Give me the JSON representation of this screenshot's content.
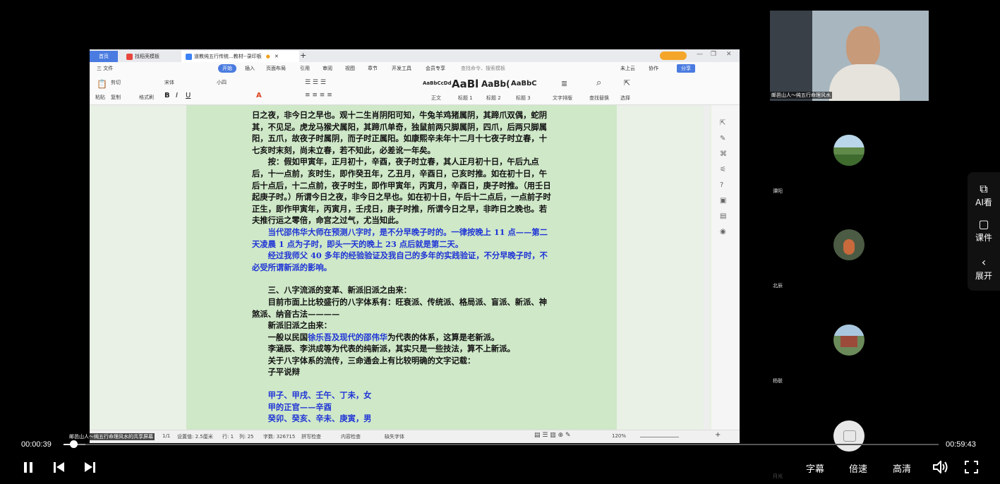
{
  "document_window": {
    "tabs": [
      {
        "label": "首页"
      },
      {
        "label": "找稻壳模板"
      },
      {
        "label": "道教纯五行传统...教材--录印板"
      }
    ],
    "menus": [
      "三 文件",
      "开始",
      "插入",
      "页面布局",
      "引用",
      "审阅",
      "视图",
      "章节",
      "开发工具",
      "会员专享",
      "查找命令、搜索模板"
    ],
    "right_menu": [
      "未上云",
      "协作",
      "分享"
    ],
    "ribbon": {
      "clipboard": [
        "粘贴",
        "剪切",
        "复制",
        "格式刷"
      ],
      "font_name": "宋体",
      "font_size": "小四",
      "styles": [
        {
          "preview": "AaBbCcDd",
          "label": "正文"
        },
        {
          "preview": "AaBl",
          "label": "标题 1"
        },
        {
          "preview": "AaBb(",
          "label": "标题 2"
        },
        {
          "preview": "AaBbC",
          "label": "标题 3"
        }
      ],
      "tools": [
        "文字排版",
        "查找替换",
        "选择"
      ]
    },
    "page_paragraphs": [
      {
        "text": "日之夜，非今日之早也。观十二生肖阴阳可知，牛兔羊鸡猪属阴，其蹄爪双偶，蛇阴其，不见足。虎龙马猴犬属阳，其蹄爪单奇，独鼠前两只脚属阴，四爪，后两只脚属阳，五爪，故夜子时属阴，而子时正属阳。如康熙辛未年十二月十七夜子时立春，十七亥时末刻，尚未立春，若不知此，必差讹一年矣。",
        "style": "plain"
      },
      {
        "text": "按：假如甲寅年，正月初十，辛酉，夜子时立春，其人正月初十日，午后九点后，十一点前，亥时生，即作癸丑年，乙丑月，辛酉日，己亥时推。如在初十日，午后十点后，十二点前，夜子时生，即作甲寅年，丙寅月，辛酉日，庚子时推。（用壬日起庚子时。）所谓今日之夜，非今日之早也。如在初十日，午后十二点后，一点前子时正生，即作甲寅年，丙寅月，壬戌日，庚子时推，所谓今日之早，非昨日之晚也。若夫推行运之零倍，命宫之过气，尤当知此。",
        "style": "indent"
      },
      {
        "text": "当代邵伟华大师在预测八字时，是不分早晚子时的。一律按晚上 11 点——第二天凌晨 1 点为子时，即头一天的晚上 23 点后就是第二天。",
        "style": "blue-indent"
      },
      {
        "text": "经过我师父 40 多年的经验验证及我自己的多年的实践验证，不分早晚子时，不必受所谓新派的影响。",
        "style": "blue-indent"
      },
      {
        "text": "",
        "style": "gap"
      },
      {
        "text": "三、八字流派的变革、新派旧派之由来：",
        "style": "indent"
      },
      {
        "text": "目前市面上比较盛行的八字体系有：旺衰派、传统派、格局派、盲派、新派、神煞派、纳音古法————",
        "style": "indent"
      },
      {
        "text": "新派旧派之由来：",
        "style": "indent"
      },
      {
        "text": "一般以民国徐乐吾及现代的邵伟华为代表的体系，这算是老新派。",
        "style": "mixed-indent"
      },
      {
        "text": "李涵辰、李洪成等为代表的纯新派，其实只是一些技法，算不上新派。",
        "style": "indent"
      },
      {
        "text": "关于八字体系的流传，三命通会上有比较明确的文字记载：",
        "style": "indent"
      },
      {
        "text": "子平说辩",
        "style": "indent"
      },
      {
        "text": "",
        "style": "gap"
      },
      {
        "text": "甲子、甲戌、壬午、丁未，女",
        "style": "blue-indent"
      },
      {
        "text": "甲的正官——辛酉",
        "style": "blue-indent"
      },
      {
        "text": "癸卯、癸亥、辛未、庚寅，男",
        "style": "blue-indent"
      }
    ],
    "mixed_line": {
      "prefix": "一般以民国",
      "blue": "徐乐吾及现代的邵伟华",
      "suffix": "为代表的体系，这算是老新派。"
    },
    "status": {
      "page": "1/1",
      "setting": "设置值: 2.5厘米",
      "line": "行: 1",
      "col": "列: 25",
      "words": "字数: 326715",
      "spell": "拼写检查",
      "content": "内容检查",
      "font_missing": "缺失字体",
      "zoom": "120%"
    },
    "share_caption": "邮邑山人～纯五行命理风水的共享屏幕"
  },
  "participants": [
    {
      "name": "邮邑山人～纯五行命理风水",
      "role": "host"
    },
    {
      "name": "谭阳"
    },
    {
      "name": "北辰"
    },
    {
      "name": "杨联"
    },
    {
      "name": "月光"
    }
  ],
  "player": {
    "current_time": "00:00:39",
    "total_time": "00:59:43",
    "progress": 0.011,
    "subtitles_label": "字幕",
    "speed_label": "倍速",
    "quality_label": "高清"
  },
  "side_panel": {
    "items": [
      {
        "label": "AI看",
        "icon": "ai-view-icon"
      },
      {
        "label": "课件",
        "icon": "courseware-icon"
      },
      {
        "label": "展开",
        "icon": "chevron-left-icon"
      }
    ]
  },
  "colors": {
    "page_green": "#cfe8c8",
    "doc_blue_text": "#1f34d6",
    "accent_blue": "#4a7be0"
  }
}
